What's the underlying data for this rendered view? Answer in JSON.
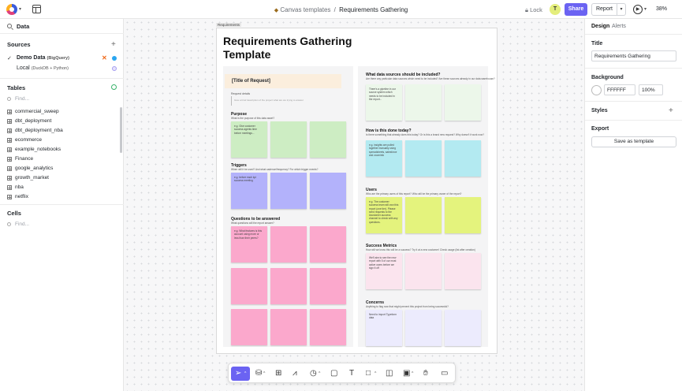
{
  "header": {
    "breadcrumb_parent": "Canvas templates",
    "breadcrumb_separator": "/",
    "breadcrumb_current": "Requirements Gathering",
    "lock_label": "Lock",
    "avatar_initial": "T",
    "share_label": "Share",
    "report_label": "Report",
    "zoom": "38%"
  },
  "sidebar": {
    "search_value": "Data",
    "sources_title": "Sources",
    "sources": [
      {
        "name": "Demo Data",
        "detail": "(BigQuery)"
      },
      {
        "name": "Local",
        "detail": "(DuckDB + Python)"
      }
    ],
    "tables_title": "Tables",
    "tables_find_placeholder": "Find...",
    "tables": [
      "commercial_sweep",
      "dbt_deployment",
      "dbt_deployment_nba",
      "ecommerce",
      "example_notebooks",
      "Finance",
      "google_analytics",
      "growth_market",
      "nba",
      "netflix"
    ],
    "cells_title": "Cells",
    "cells_find_placeholder": "Find..."
  },
  "canvas": {
    "frame_label": "Requirements",
    "title_line1": "Requirements Gathering",
    "title_line2": "Template",
    "left": {
      "request_title": "[Title of Request]",
      "request_details_label": "Request details",
      "request_details_hint": "Give a brief description of the project what are we trying to answer",
      "purpose": {
        "heading": "Purpose",
        "question": "What is the purpose of this data asset?",
        "note": "e.g. Give customer success agents time before meetings..."
      },
      "triggers": {
        "heading": "Triggers",
        "question": "When will it be used? And what cadence/frequency? For which trigger events?",
        "note": "e.g. before each kpi success meeting"
      },
      "questions": {
        "heading": "Questions to be answered",
        "question": "What questions will the report answer?",
        "note": "e.g. What features is this account using more or less than their peers?"
      }
    },
    "right": {
      "data_sources": {
        "heading": "What data sources should be included?",
        "question": "Are there any particular data sources which need to be included? Are these sources already in our data warehouse?",
        "note": "There's a pipeline in our source system which needs to be included in the report..."
      },
      "done_today": {
        "heading": "How is this done today?",
        "question": "Is there something that already does this today? Or is this a brand new request? Why doesn't it work now?",
        "note": "e.g. insights are pulled together manually using spreadsheets, salesforce and zoominfo"
      },
      "users": {
        "heading": "Users",
        "question": "Who are the primary users of this report? Who will be the primary owner of the report?",
        "note": "e.g. The customer success team will own this report (one tier). Please send requests to the #customer-success channel to check with any questions."
      },
      "success": {
        "heading": "Success Metrics",
        "question": "How will we know this will be a success? Try it at a new customer! Check usage (list after creation)",
        "note": "We'll aim to see the new report with 5 of our most active users before we sign it off"
      },
      "concerns": {
        "heading": "Concerns",
        "question": "Anything to flag now that might prevent this project from being successful?",
        "note": "Need to import Typeform data"
      }
    }
  },
  "right_panel": {
    "tab_design": "Design",
    "tab_alerts": "Alerts",
    "title_label": "Title",
    "title_value": "Requirements Gathering",
    "background_label": "Background",
    "background_color": "FFFFFF",
    "background_opacity": "100%",
    "styles_label": "Styles",
    "export_label": "Export",
    "save_template_label": "Save as template"
  },
  "colors": {
    "accent": "#6b63f2",
    "sticky_green": "#cdedc3",
    "sticky_purple": "#b3b2fb",
    "sticky_pink": "#fba8cc",
    "sticky_light_green": "#ecf7ea",
    "sticky_cyan": "#b3eaf1",
    "sticky_lime": "#e4f37d",
    "sticky_light_pink": "#fbe4ee",
    "sticky_lavender": "#ecebfd"
  },
  "toolbar_icons": [
    "select-pointer-icon",
    "database-icon",
    "table-icon",
    "chart-icon",
    "clock-icon",
    "sticky-note-icon",
    "text-icon",
    "shape-icon",
    "frame-icon",
    "image-icon",
    "hand-icon",
    "comment-icon"
  ]
}
